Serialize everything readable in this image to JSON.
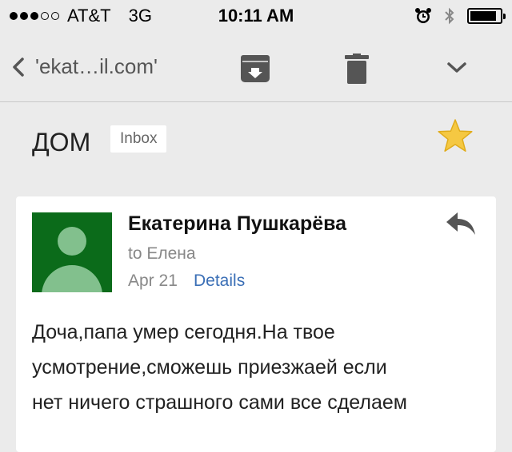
{
  "status_bar": {
    "carrier": "AT&T",
    "network": "3G",
    "time": "10:11 AM",
    "signal_filled": 3,
    "signal_total": 5,
    "battery_level": 0.9,
    "icons": [
      "alarm-icon",
      "bluetooth-icon",
      "battery-icon"
    ]
  },
  "nav": {
    "back_label": "'ekat…il.com'",
    "icons": [
      "chevron-left-icon",
      "archive-icon",
      "trash-icon",
      "chevron-down-icon"
    ]
  },
  "thread": {
    "subject": "ДОМ",
    "label": "Inbox",
    "starred": true,
    "star_color": "#f5c842"
  },
  "message": {
    "sender": "Екатерина Пушкарёва",
    "to_line": "to Елена",
    "date": "Apr 21",
    "details_link": "Details",
    "avatar_color": "#0b6b1a",
    "body_lines": [
      "Доча,папа умер сегодня.На твое",
      "усмотрение,сможешь приезжаей если",
      "нет ничего страшного сами все сделаем"
    ]
  }
}
